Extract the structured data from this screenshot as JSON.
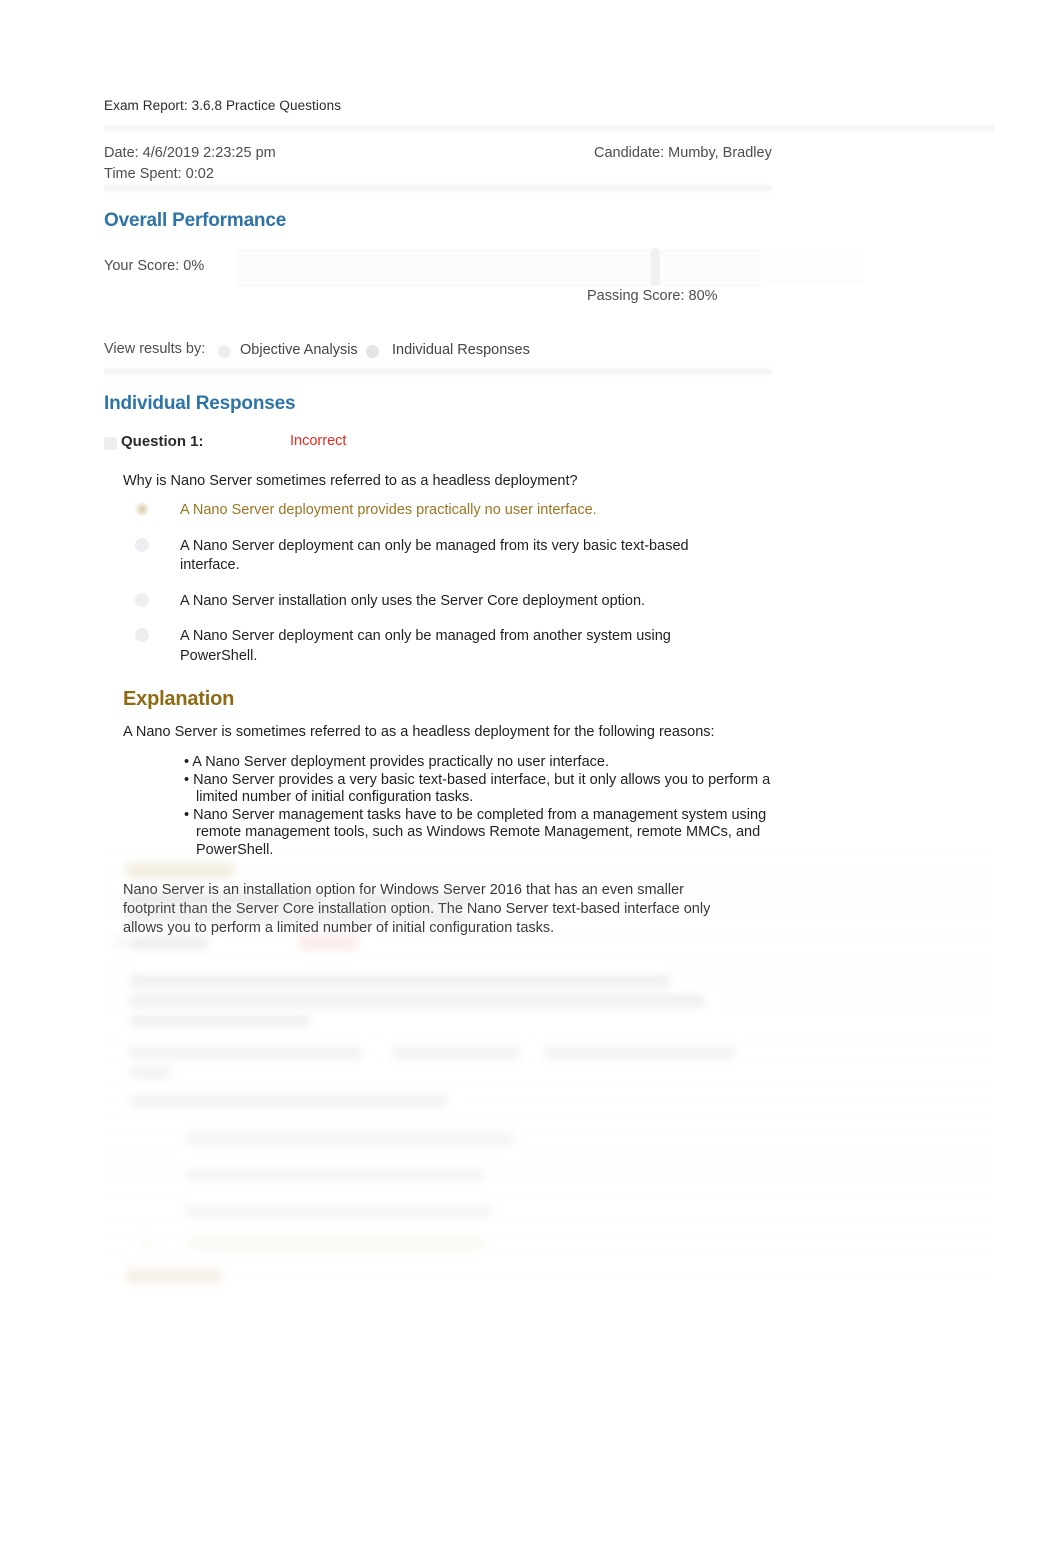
{
  "report": {
    "title": "Exam Report: 3.6.8 Practice Questions",
    "date_label": "Date: 4/6/2019 2:23:25 pm",
    "time_spent_label": "Time Spent: 0:02",
    "candidate_label": "Candidate: Mumby, Bradley"
  },
  "overall_performance": {
    "heading": "Overall Performance",
    "your_score_label": "Your Score:  0%",
    "your_score_value": 0,
    "passing_score_label": "Passing Score:  80%",
    "passing_score_value": 80
  },
  "view_results_by": {
    "label": "View results by:",
    "options": [
      {
        "label": "Objective Analysis",
        "selected": false
      },
      {
        "label": "Individual Responses",
        "selected": true
      }
    ]
  },
  "individual_responses": {
    "heading": "Individual Responses",
    "questions": [
      {
        "label": "Question 1:",
        "status": "Incorrect",
        "status_color": "#ea2a1f",
        "prompt": "Why is Nano Server sometimes referred to as a headless deployment?",
        "options": [
          {
            "text": "A Nano Server deployment provides practically no user interface.",
            "correct": true,
            "selected": false
          },
          {
            "text": "A Nano Server deployment can only be managed from its very basic text-based interface.",
            "correct": false,
            "selected": false
          },
          {
            "text": "A Nano Server installation only uses the Server Core deployment option.",
            "correct": false,
            "selected": false
          },
          {
            "text": "A Nano Server deployment can only be managed from another system using PowerShell.",
            "correct": false,
            "selected": false
          }
        ],
        "explanation": {
          "heading": "Explanation",
          "intro": "A Nano Server is sometimes referred to as a headless deployment for the following reasons:",
          "bullets": [
            "• A Nano Server deployment provides practically no user interface.",
            "• Nano Server provides a very basic text-based interface, but it only allows you to perform a limited number of initial configuration tasks.",
            "• Nano Server management tasks have to be completed from a management system using remote management tools, such as Windows Remote Management, remote MMCs, and PowerShell."
          ],
          "closing": "Nano Server is an installation option for Windows Server 2016 that has an even smaller footprint than the Server Core installation option. The Nano Server text-based interface only allows you to perform a limited number of initial configuration tasks."
        }
      }
    ]
  },
  "colors": {
    "heading_blue": "#2e74a8",
    "explanation_gold": "#8f6a14",
    "correct_gold": "#9d7522",
    "incorrect_red": "#ea2a1f",
    "page_background": "#ffffff"
  }
}
